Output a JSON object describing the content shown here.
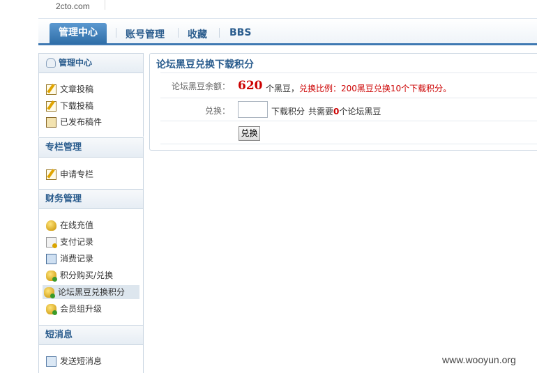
{
  "site": {
    "logo": "2cto.com"
  },
  "nav": {
    "active": "管理中心",
    "tabs": [
      "账号管理",
      "收藏",
      "BBS"
    ]
  },
  "sidebar": {
    "section1": {
      "title": "管理中心",
      "items": [
        "文章投稿",
        "下载投稿",
        "已发布稿件"
      ]
    },
    "section2": {
      "title": "专栏管理",
      "items": [
        "申请专栏"
      ]
    },
    "section3": {
      "title": "财务管理",
      "items": [
        "在线充值",
        "支付记录",
        "消费记录",
        "积分购买/兑换",
        "论坛黑豆兑换积分",
        "会员组升级"
      ]
    },
    "section4": {
      "title": "短消息",
      "items": [
        "发送短消息"
      ]
    }
  },
  "main": {
    "title": "论坛黑豆兑换下载积分",
    "balance_label": "论坛黑豆余额：",
    "balance_value": "620",
    "balance_unit": "个黑豆，",
    "ratio_text": "兑换比例：200黑豆兑换10个下载积分。",
    "exchange_label": "兑换：",
    "exchange_value": "",
    "exchange_unit": "下载积分",
    "needs_prefix": "共需要",
    "needs_value": "0",
    "needs_suffix": "个论坛黑豆",
    "submit_label": "兑换"
  },
  "watermark": "www.wooyun.org"
}
